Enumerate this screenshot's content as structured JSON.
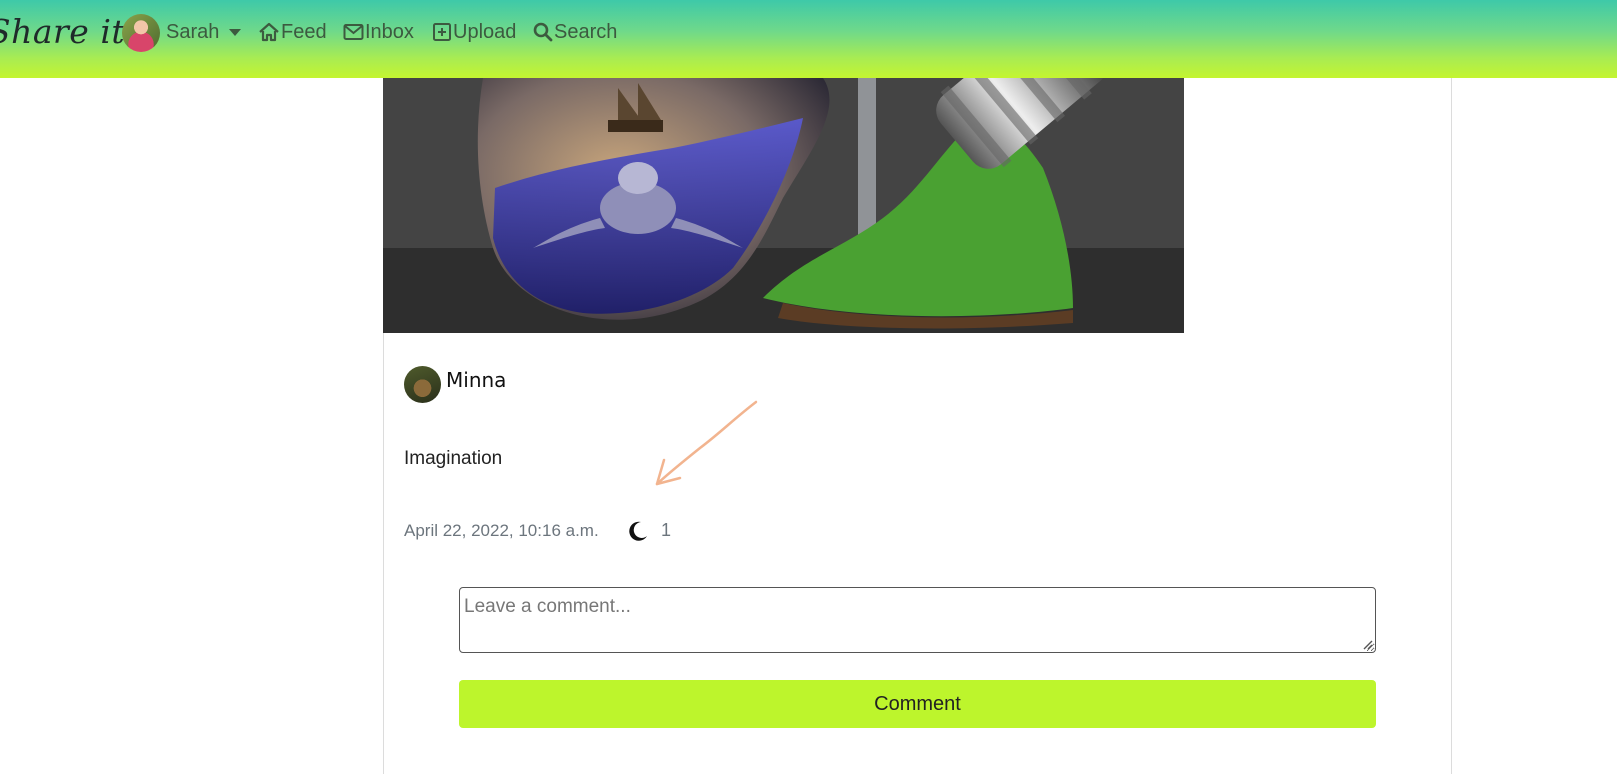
{
  "brand": {
    "name": "Share it"
  },
  "navbar": {
    "user_name": "Sarah",
    "feed_label": "Feed",
    "inbox_label": "Inbox",
    "upload_label": "Upload",
    "search_label": "Search"
  },
  "post": {
    "author": "Minna",
    "caption": "Imagination",
    "timestamp": "April 22, 2022, 10:16 a.m.",
    "like_count": "1",
    "like_icon": "crescent-moon-icon"
  },
  "comment": {
    "placeholder": "Leave a comment...",
    "button_label": "Comment"
  },
  "colors": {
    "navbar_top": "#3ec9a9",
    "navbar_bottom": "#c4f530",
    "accent": "#bdf52c",
    "nav_text": "#3c5a3f"
  }
}
